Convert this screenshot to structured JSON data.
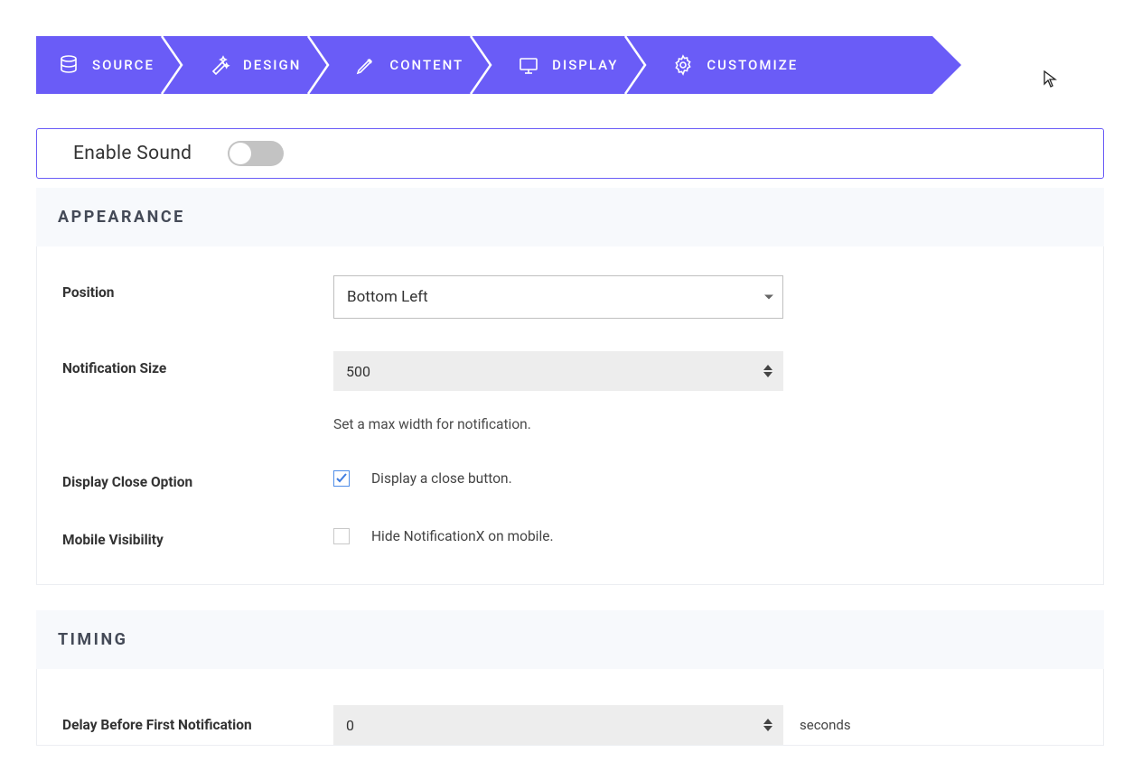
{
  "steps": [
    {
      "label": "SOURCE"
    },
    {
      "label": "DESIGN"
    },
    {
      "label": "CONTENT"
    },
    {
      "label": "DISPLAY"
    },
    {
      "label": "CUSTOMIZE"
    }
  ],
  "sound": {
    "label": "Enable Sound",
    "enabled": false
  },
  "appearance": {
    "heading": "APPEARANCE",
    "position": {
      "label": "Position",
      "value": "Bottom Left"
    },
    "notification_size": {
      "label": "Notification Size",
      "value": "500",
      "help": "Set a max width for notification."
    },
    "display_close": {
      "label": "Display Close Option",
      "checkbox_label": "Display a close button.",
      "checked": true
    },
    "mobile_visibility": {
      "label": "Mobile Visibility",
      "checkbox_label": "Hide NotificationX on mobile.",
      "checked": false
    }
  },
  "timing": {
    "heading": "TIMING",
    "delay_first": {
      "label": "Delay Before First Notification",
      "value": "0",
      "unit": "seconds"
    }
  }
}
